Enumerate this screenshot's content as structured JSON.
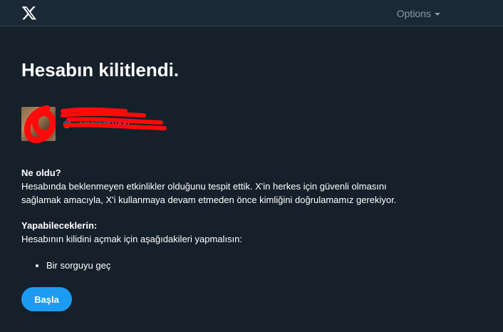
{
  "header": {
    "logo_icon": "x-logo-icon",
    "options_label": "Options"
  },
  "main": {
    "title": "Hesabın kilitlendi.",
    "account": {
      "display_name": "",
      "handle": "@...omaloist1900"
    },
    "what_happened": {
      "heading": "Ne oldu?",
      "text_line1": "Hesabında beklenmeyen etkinlikler olduğunu tespit ettik. X'in herkes için güvenli olmasını",
      "text_line2": "sağlamak amacıyla, X'i kullanmaya devam etmeden önce kimliğini doğrulamamız gerekiyor."
    },
    "what_you_can_do": {
      "heading": "Yapabileceklerin:",
      "text": "Hesabının kilidini açmak için aşağıdakileri yapmalısın:",
      "steps": [
        "Bir sorguyu geç"
      ]
    },
    "start_button": "Başla"
  },
  "colors": {
    "background": "#15202b",
    "topbar": "#1b2836",
    "accent": "#1d9bf0",
    "muted": "#8b98a5"
  }
}
